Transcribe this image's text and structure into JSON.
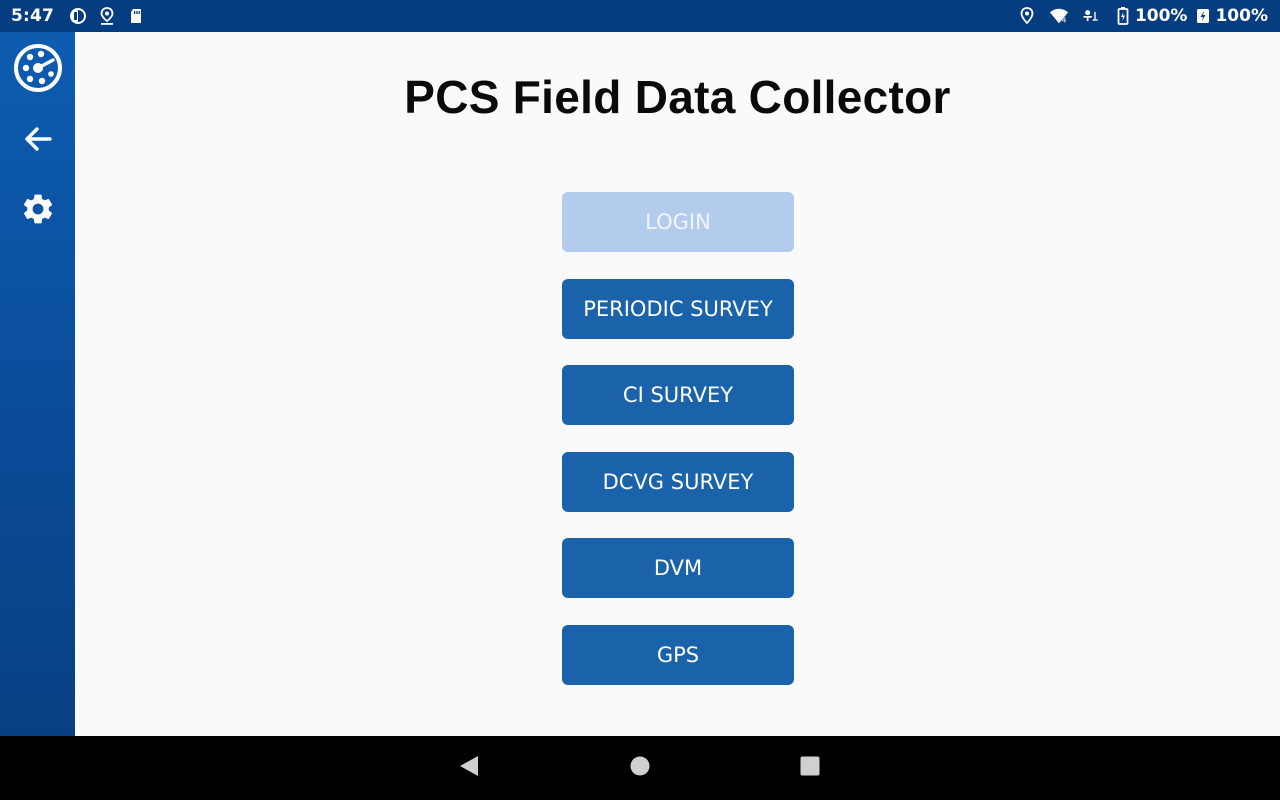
{
  "status_bar": {
    "time": "5:47",
    "left_icons": [
      "app-notification-icon",
      "location-pin-icon",
      "sd-card-icon"
    ],
    "right_icons": [
      "location-icon",
      "wifi-icon",
      "signal-icon",
      "battery-icon",
      "battery-charging-icon"
    ],
    "battery_level": "100%",
    "battery_level_secondary": "100%"
  },
  "side_rail": {
    "items": [
      {
        "icon": "app-logo-icon"
      },
      {
        "icon": "back-arrow-icon"
      },
      {
        "icon": "settings-gear-icon"
      }
    ]
  },
  "main": {
    "title": "PCS Field Data Collector",
    "buttons": [
      {
        "label": "LOGIN",
        "enabled": false
      },
      {
        "label": "PERIODIC SURVEY",
        "enabled": true
      },
      {
        "label": "CI SURVEY",
        "enabled": true
      },
      {
        "label": "DCVG SURVEY",
        "enabled": true
      },
      {
        "label": "DVM",
        "enabled": true
      },
      {
        "label": "GPS",
        "enabled": true
      }
    ]
  },
  "nav_bar": {
    "icons": [
      "back-triangle-icon",
      "home-circle-icon",
      "recents-square-icon"
    ]
  },
  "colors": {
    "status_bar": "#063d80",
    "rail": "#0b4f9e",
    "button": "#1a63aa",
    "button_disabled": "#b3cbed",
    "background": "#fafafa"
  }
}
